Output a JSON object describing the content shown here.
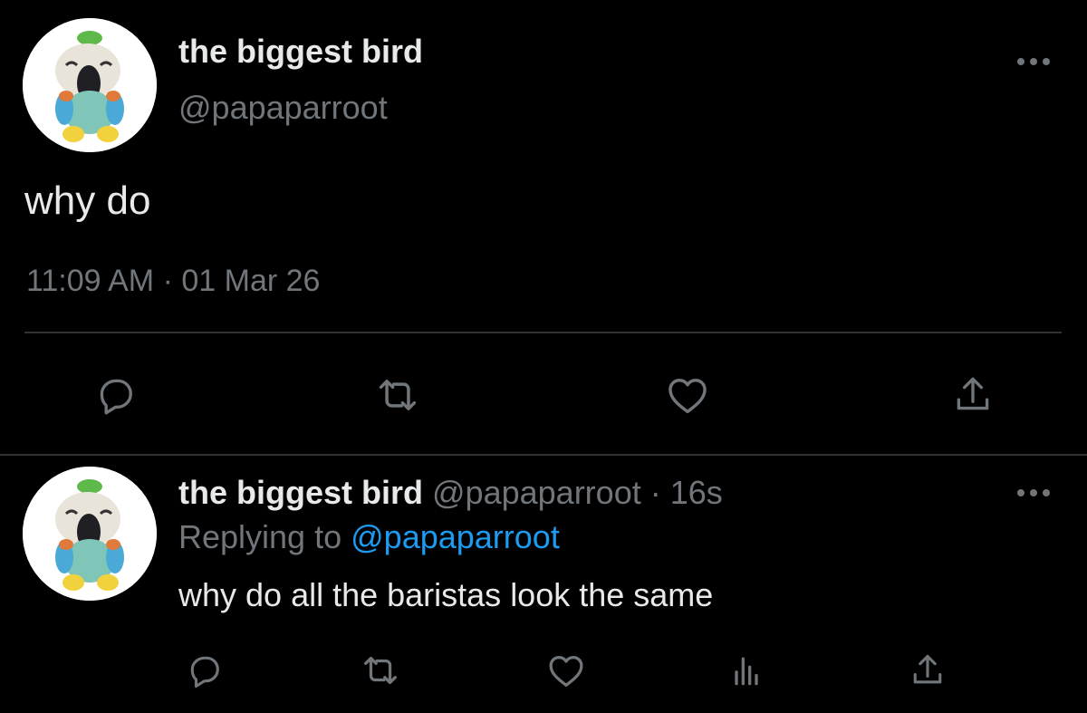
{
  "colors": {
    "background": "#000000",
    "text_primary": "#e7e9ea",
    "text_secondary": "#71767b",
    "link": "#1d9bf0",
    "divider": "#2f3336"
  },
  "main_tweet": {
    "avatar_icon": "parrot-plush-avatar",
    "display_name": "the biggest bird",
    "handle": "@papaparroot",
    "more_icon": "more-horizontal-icon",
    "text": "why do",
    "timestamp": "11:09 AM",
    "separator": "·",
    "date": "01 Mar 26",
    "actions": [
      {
        "name": "reply",
        "icon": "reply-icon"
      },
      {
        "name": "retweet",
        "icon": "retweet-icon"
      },
      {
        "name": "like",
        "icon": "heart-icon"
      },
      {
        "name": "share",
        "icon": "share-icon"
      }
    ]
  },
  "reply_tweet": {
    "avatar_icon": "parrot-plush-avatar",
    "display_name": "the biggest bird",
    "handle": "@papaparroot",
    "separator": "·",
    "time": "16s",
    "replying_prefix": "Replying to",
    "replying_to": "@papaparroot",
    "text": "why do all the baristas look the same",
    "more_icon": "more-horizontal-icon",
    "actions": [
      {
        "name": "reply",
        "icon": "reply-icon"
      },
      {
        "name": "retweet",
        "icon": "retweet-icon"
      },
      {
        "name": "like",
        "icon": "heart-icon"
      },
      {
        "name": "analytics",
        "icon": "analytics-icon"
      },
      {
        "name": "share",
        "icon": "share-icon"
      }
    ]
  }
}
